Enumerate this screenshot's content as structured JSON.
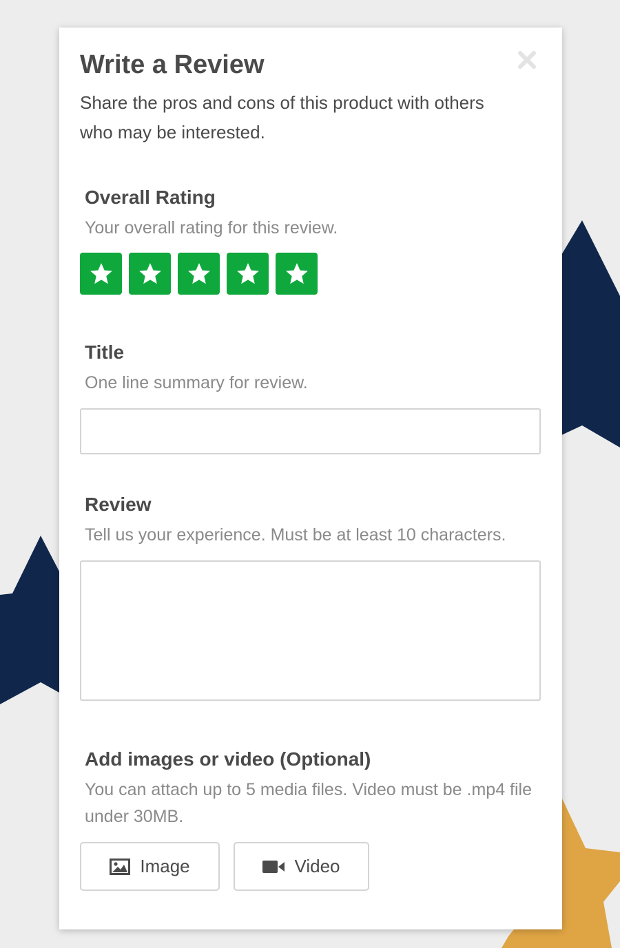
{
  "modal": {
    "title": "Write a Review",
    "subtitle": "Share the pros and cons of this product with others who may be interested.",
    "close_icon": "close-icon"
  },
  "rating": {
    "label": "Overall Rating",
    "hint": "Your overall rating for this review.",
    "value": 5,
    "max": 5,
    "star_color": "#0fa83c",
    "star_icon": "star-icon"
  },
  "title_field": {
    "label": "Title",
    "hint": "One line summary for review.",
    "value": ""
  },
  "review_field": {
    "label": "Review",
    "hint": "Tell us your experience. Must be at least 10 characters.",
    "value": ""
  },
  "media": {
    "label": "Add images or video (Optional)",
    "hint": "You can attach up to 5 media files. Video must be .mp4 file under 30MB.",
    "image_button": "Image",
    "image_icon": "image-icon",
    "video_button": "Video",
    "video_icon": "video-camera-icon"
  },
  "colors": {
    "background": "#ededed",
    "navy_star": "#10264b",
    "gold_star": "#dfa444",
    "text": "#4a4a4a",
    "hint_text": "#8a8a8a"
  }
}
